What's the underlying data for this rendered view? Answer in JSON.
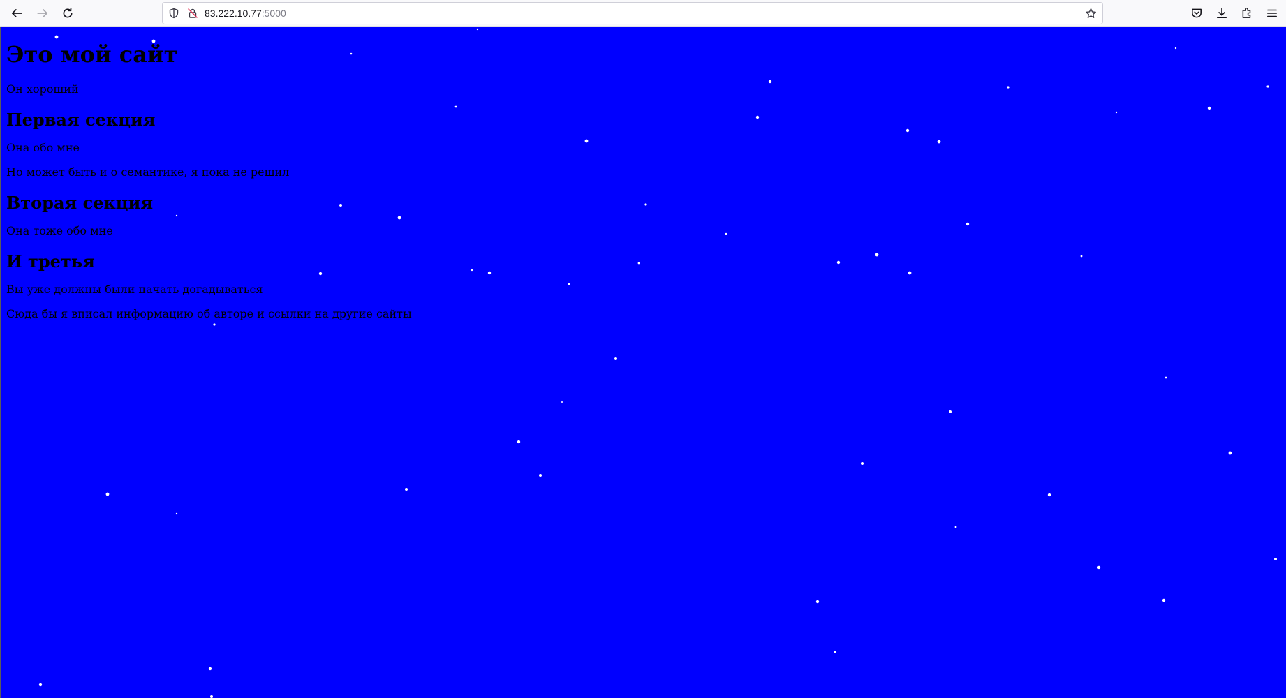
{
  "browser": {
    "url_host": "83.222.10.77",
    "url_port": ":5000",
    "icons": {
      "back": "arrow-left-icon",
      "forward": "arrow-right-icon",
      "reload": "reload-icon",
      "shield": "shield-icon",
      "insecure": "insecure-lock-icon",
      "bookmark": "star-icon",
      "pocket": "pocket-icon",
      "downloads": "download-icon",
      "extensions": "puzzle-icon",
      "menu": "hamburger-menu-icon"
    }
  },
  "page": {
    "background_color": "#0000ff",
    "star_color": "#ffffff",
    "title": "Это мой сайт",
    "intro": "Он хороший",
    "sections": [
      {
        "heading": "Первая секция",
        "paragraphs": [
          "Она обо мне",
          "Но может быть и о семантике, я пока не решил"
        ]
      },
      {
        "heading": "Вторая секция",
        "paragraphs": [
          "Она тоже обо мне"
        ]
      },
      {
        "heading": "И третья",
        "paragraphs": [
          "Вы уже должны были начать догадываться"
        ]
      }
    ],
    "footer": "Сюда бы я вписал информацию об авторе и ссылки на другие сайты"
  }
}
